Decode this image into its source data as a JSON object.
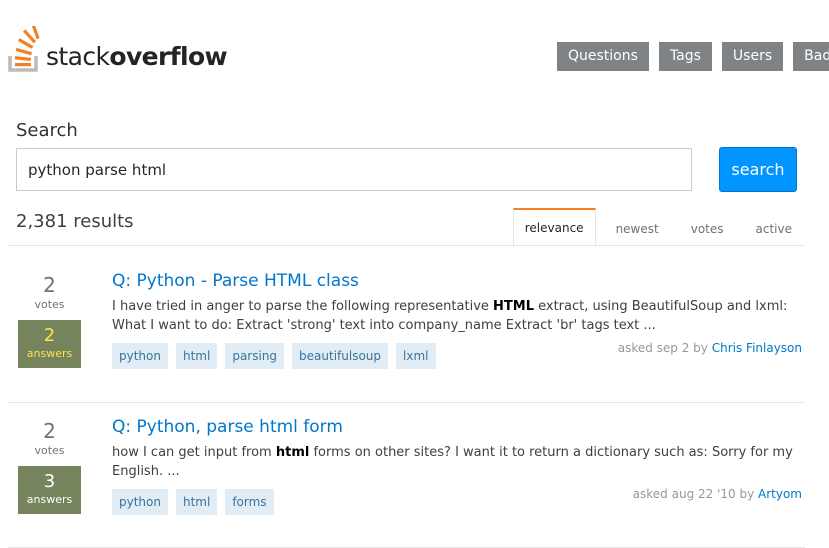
{
  "header": {
    "logo_text_light": "stack",
    "logo_text_bold": "overflow",
    "nav": [
      {
        "label": "Questions",
        "icon": "none"
      },
      {
        "label": "Tags"
      },
      {
        "label": "Users"
      },
      {
        "label": "Badges"
      }
    ]
  },
  "search": {
    "label": "Search",
    "value": "python parse html",
    "button_label": "search"
  },
  "results_header": {
    "count_text": "2,381 results",
    "tabs": [
      {
        "label": "relevance",
        "active": true
      },
      {
        "label": "newest",
        "active": false
      },
      {
        "label": "votes",
        "active": false
      },
      {
        "label": "active",
        "active": false
      }
    ]
  },
  "results": [
    {
      "votes": "2",
      "votes_label": "votes",
      "answers": "2",
      "answers_label": "answers",
      "title": "Q: Python - Parse HTML class",
      "excerpt_before": "I have tried in anger to parse the following representative ",
      "excerpt_highlight": "HTML",
      "excerpt_after": " extract, using BeautifulSoup and lxml: What I want to do: Extract 'strong' text into company_name Extract 'br' tags text ...",
      "tags": [
        "python",
        "html",
        "parsing",
        "beautifulsoup",
        "lxml"
      ],
      "asked_text": "asked sep 2 by ",
      "author": "Chris Finlayson"
    },
    {
      "votes": "2",
      "votes_label": "votes",
      "answers": "3",
      "answers_label": "answers",
      "title": "Q: Python, parse html form",
      "excerpt_before": "how I can get input from ",
      "excerpt_highlight": "html",
      "excerpt_after": " forms on other sites? I want it to return a dictionary such as: Sorry for my English. ...",
      "tags": [
        "python",
        "html",
        "forms"
      ],
      "asked_text": "asked aug 22 '10 by ",
      "author": "Artyom"
    }
  ],
  "colors": {
    "link": "#0077cc",
    "search_button": "#0095ff",
    "nav_button": "#7f8386",
    "answers_box": "#75845c",
    "accepted_gold": "#ffe34a",
    "tab_active_accent": "#f48024",
    "tag_bg": "#e1ecf4"
  }
}
